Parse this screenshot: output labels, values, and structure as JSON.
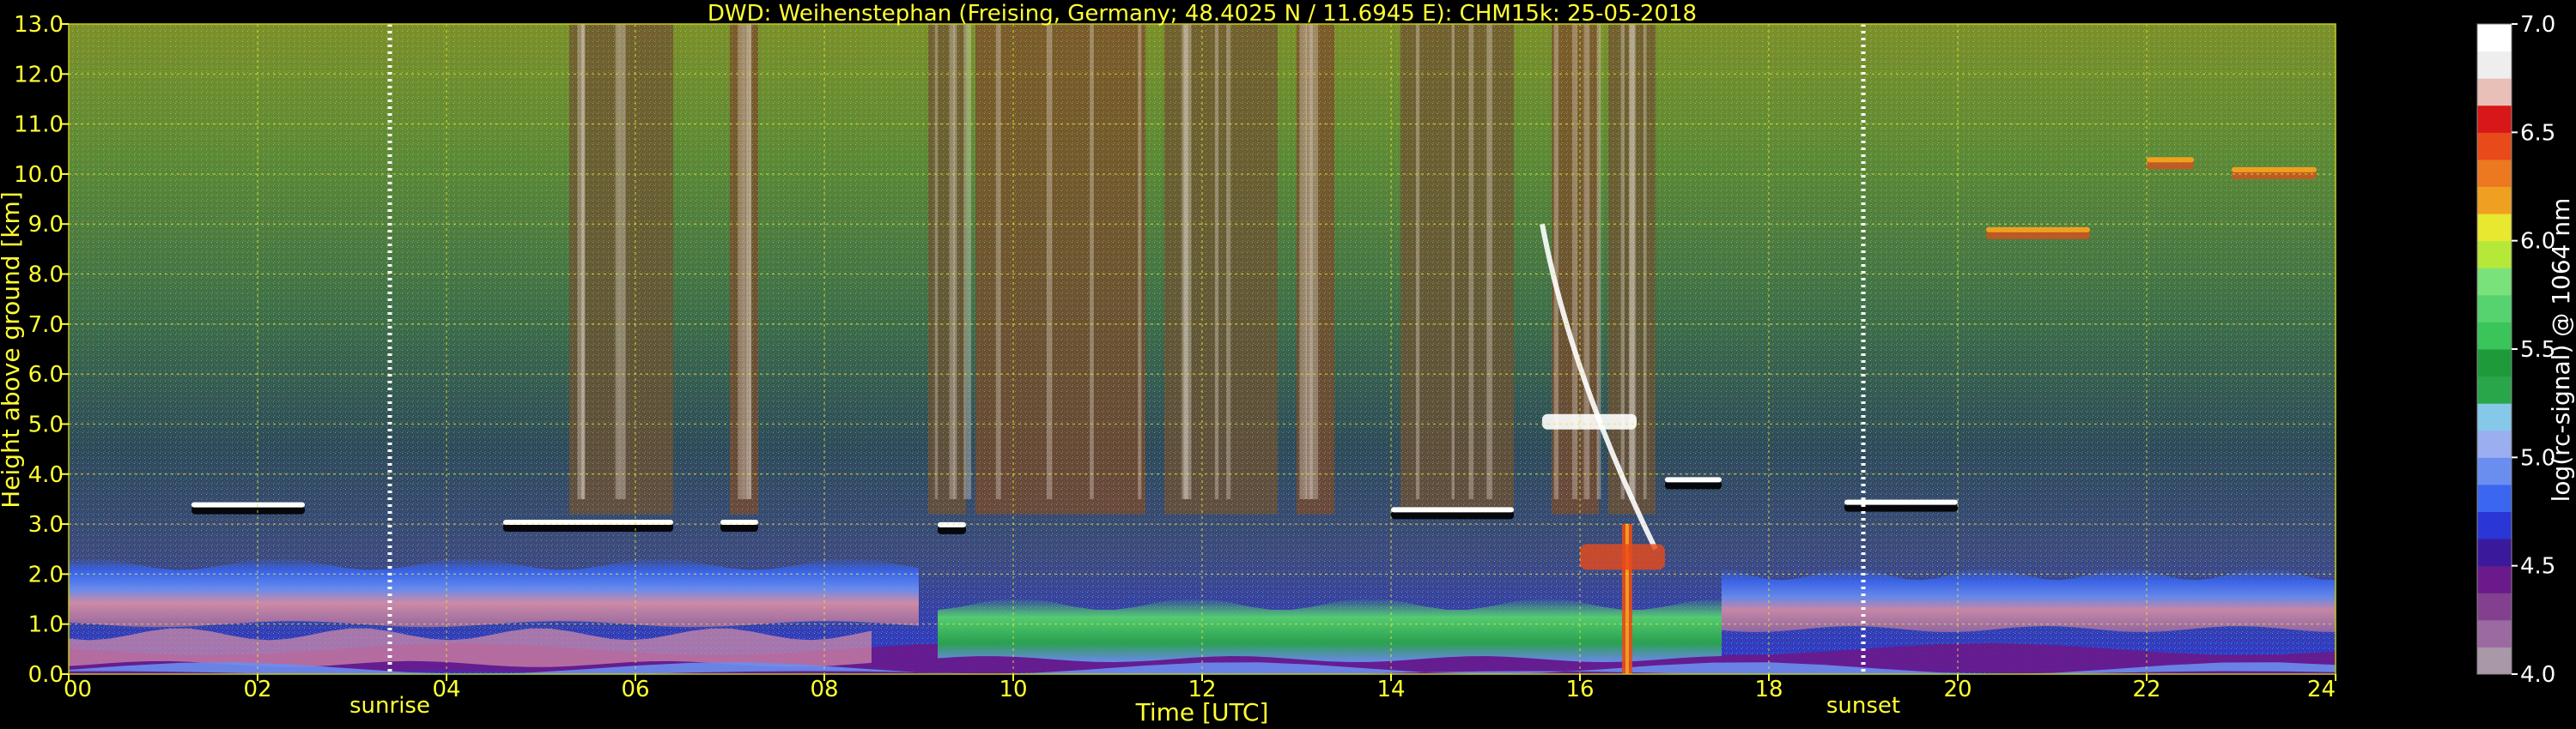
{
  "chart_data": {
    "type": "heatmap",
    "title": "DWD: Weihenstephan (Freising, Germany; 48.4025 N / 11.6945 E):    CHM15k: 25-05-2018",
    "xlabel": "Time [UTC]",
    "ylabel": "Height above ground [km]",
    "xlim": [
      0,
      24
    ],
    "ylim": [
      0,
      13
    ],
    "x_ticks": [
      0,
      2,
      4,
      6,
      8,
      10,
      12,
      14,
      16,
      18,
      20,
      22,
      24
    ],
    "x_tick_labels": [
      "00",
      "02",
      "04",
      "06",
      "08",
      "10",
      "12",
      "14",
      "16",
      "18",
      "20",
      "22",
      "24"
    ],
    "y_ticks": [
      0,
      1,
      2,
      3,
      4,
      5,
      6,
      7,
      8,
      9,
      10,
      11,
      12,
      13
    ],
    "y_tick_labels": [
      "0.0",
      "1.0",
      "2.0",
      "3.0",
      "4.0",
      "5.0",
      "6.0",
      "7.0",
      "8.0",
      "9.0",
      "10.0",
      "11.0",
      "12.0",
      "13.0"
    ],
    "grid": true,
    "annotations": [
      {
        "label": "sunrise",
        "x": 3.4
      },
      {
        "label": "sunset",
        "x": 19.0
      }
    ],
    "colorbar": {
      "label": "log(rc-signal) @ 1064 nm",
      "range": [
        4.0,
        7.0
      ],
      "ticks": [
        4.0,
        4.5,
        5.0,
        5.5,
        6.0,
        6.5,
        7.0
      ],
      "tick_labels": [
        "4.0",
        "4.5",
        "5.0",
        "5.5",
        "6.0",
        "6.5",
        "7.0"
      ],
      "colors": [
        "#a898a8",
        "#9a6aa0",
        "#82408e",
        "#6a1a8a",
        "#3a1a9a",
        "#2a36d6",
        "#3a66f0",
        "#6a8ef0",
        "#9aaef0",
        "#86c8e8",
        "#2aa64a",
        "#1e9a3a",
        "#3ac45a",
        "#56d26e",
        "#7ae27a",
        "#b6e83a",
        "#e8e830",
        "#f0a020",
        "#ec7820",
        "#e84a1a",
        "#d81818",
        "#e8c0b8",
        "#eeeeee",
        "#ffffff"
      ]
    },
    "features": {
      "boundary_layer": {
        "height_km": [
          0.2,
          0.8
        ],
        "x_range": [
          0,
          24
        ]
      },
      "residual_layer": {
        "height_km": [
          1.0,
          2.2
        ],
        "x_range": [
          0,
          9
        ]
      },
      "convective_layer": {
        "height_km": [
          0.3,
          1.4
        ],
        "x_range": [
          9.2,
          17.5
        ]
      },
      "cloud_layers": [
        {
          "x_range": [
            1.3,
            2.5
          ],
          "height_km": 3.3
        },
        {
          "x_range": [
            4.6,
            6.4
          ],
          "height_km": 2.95
        },
        {
          "x_range": [
            6.9,
            7.3
          ],
          "height_km": 2.95
        },
        {
          "x_range": [
            9.2,
            9.5
          ],
          "height_km": 2.9
        },
        {
          "x_range": [
            14.0,
            15.3
          ],
          "height_km": 3.2
        },
        {
          "x_range": [
            16.9,
            17.5
          ],
          "height_km": 3.8
        },
        {
          "x_range": [
            18.8,
            20.0
          ],
          "height_km": 3.35
        },
        {
          "x_range": [
            22.0,
            22.5
          ],
          "height_km": 10.2
        },
        {
          "x_range": [
            22.9,
            23.8
          ],
          "height_km": 10.0
        },
        {
          "x_range": [
            20.3,
            21.4
          ],
          "height_km": 8.8
        }
      ],
      "cirrus_fall": {
        "x": [
          15.6,
          16.8
        ],
        "height_km": [
          9.0,
          2.5
        ]
      },
      "precip_band": {
        "x": 16.5,
        "height_km": [
          0.0,
          3.0
        ]
      }
    }
  }
}
